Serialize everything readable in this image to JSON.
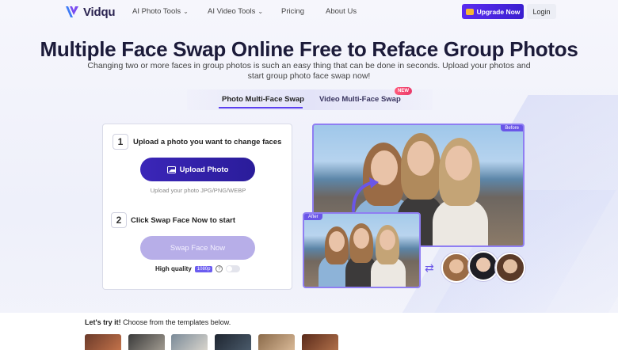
{
  "brand": {
    "name": "Vidqu"
  },
  "nav": {
    "items": [
      {
        "label": "AI Photo Tools",
        "dropdown": true
      },
      {
        "label": "AI Video Tools",
        "dropdown": true
      },
      {
        "label": "Pricing",
        "dropdown": false
      },
      {
        "label": "About Us",
        "dropdown": false
      }
    ],
    "upgrade_label": "Upgrade Now",
    "login_label": "Login"
  },
  "hero": {
    "title": "Multiple Face Swap Online Free to Reface Group Photos",
    "subtitle": "Changing two or more faces in group photos is such an easy thing that can be done in seconds. Upload your photos and start group photo face swap now!"
  },
  "tabs": [
    {
      "label": "Photo Multi-Face Swap",
      "active": true
    },
    {
      "label": "Video Multi-Face Swap",
      "active": false,
      "badge": "NEW"
    }
  ],
  "panel": {
    "step1": {
      "number": "1",
      "text": "Upload a photo you want to change faces"
    },
    "upload_button": "Upload Photo",
    "upload_hint": "Upload your photo JPG/PNG/WEBP",
    "step2": {
      "number": "2",
      "text": "Click Swap Face Now to start"
    },
    "swap_button": "Swap Face Now",
    "quality_label": "High quality",
    "quality_badge": "1080p",
    "help": "?"
  },
  "preview": {
    "before_tag": "Before",
    "after_tag": "After"
  },
  "templates": {
    "lead_bold": "Let's try it!",
    "lead_text": " Choose from the templates below."
  },
  "colors": {
    "accent": "#5b2cf0",
    "button_primary": "#3b26b8",
    "button_disabled": "#b7aee8",
    "frame": "#8f7ef2"
  }
}
